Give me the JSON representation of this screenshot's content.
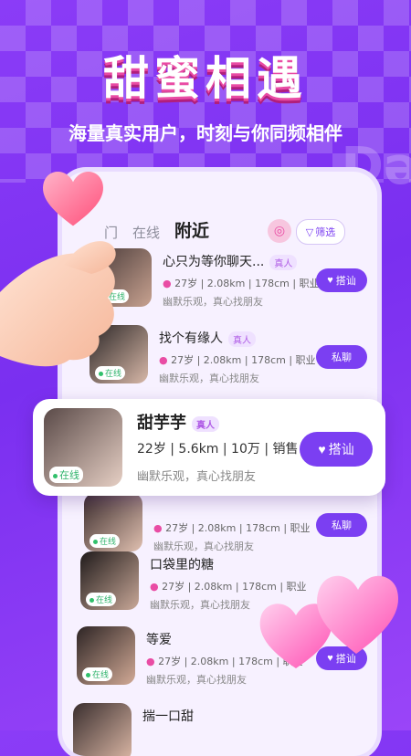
{
  "banner": {
    "title": "甜蜜相遇",
    "subtitle": "海量真实用户，时刻与你同频相伴"
  },
  "tabs": [
    {
      "label": "门"
    },
    {
      "label": "在线"
    },
    {
      "label": "附近"
    }
  ],
  "filter_label": "筛选",
  "verify_label": "真人",
  "online_label": "在线",
  "users": [
    {
      "name": "心只为等你聊天...",
      "meta": "27岁 | 2.08km | 178cm | 职业",
      "bio": "幽默乐观，真心找朋友",
      "action": "搭讪"
    },
    {
      "name": "找个有缘人",
      "meta": "27岁 | 2.08km | 178cm | 职业",
      "bio": "幽默乐观，真心找朋友",
      "action": "私聊"
    },
    {
      "name": "",
      "meta": "27岁 | 2.08km | 178cm | 职业",
      "bio": "幽默乐观，真心找朋友",
      "action": "私聊"
    },
    {
      "name": "口袋里的糖",
      "meta": "27岁 | 2.08km | 178cm | 职业",
      "bio": "幽默乐观，真心找朋友",
      "action": ""
    },
    {
      "name": "等爱",
      "meta": "27岁 | 2.08km | 178cm | 职业",
      "bio": "幽默乐观，真心找朋友",
      "action": "搭讪"
    },
    {
      "name": "揣一口甜",
      "meta": "",
      "bio": "",
      "action": ""
    }
  ],
  "featured": {
    "name": "甜芋芋",
    "meta": "22岁 | 5.6km | 10万 | 销售",
    "bio": "幽默乐观，真心找朋友",
    "action": "搭讪"
  },
  "colors": {
    "accent": "#7b3ff2",
    "pink": "#e94ca4",
    "online": "#31c06b"
  }
}
